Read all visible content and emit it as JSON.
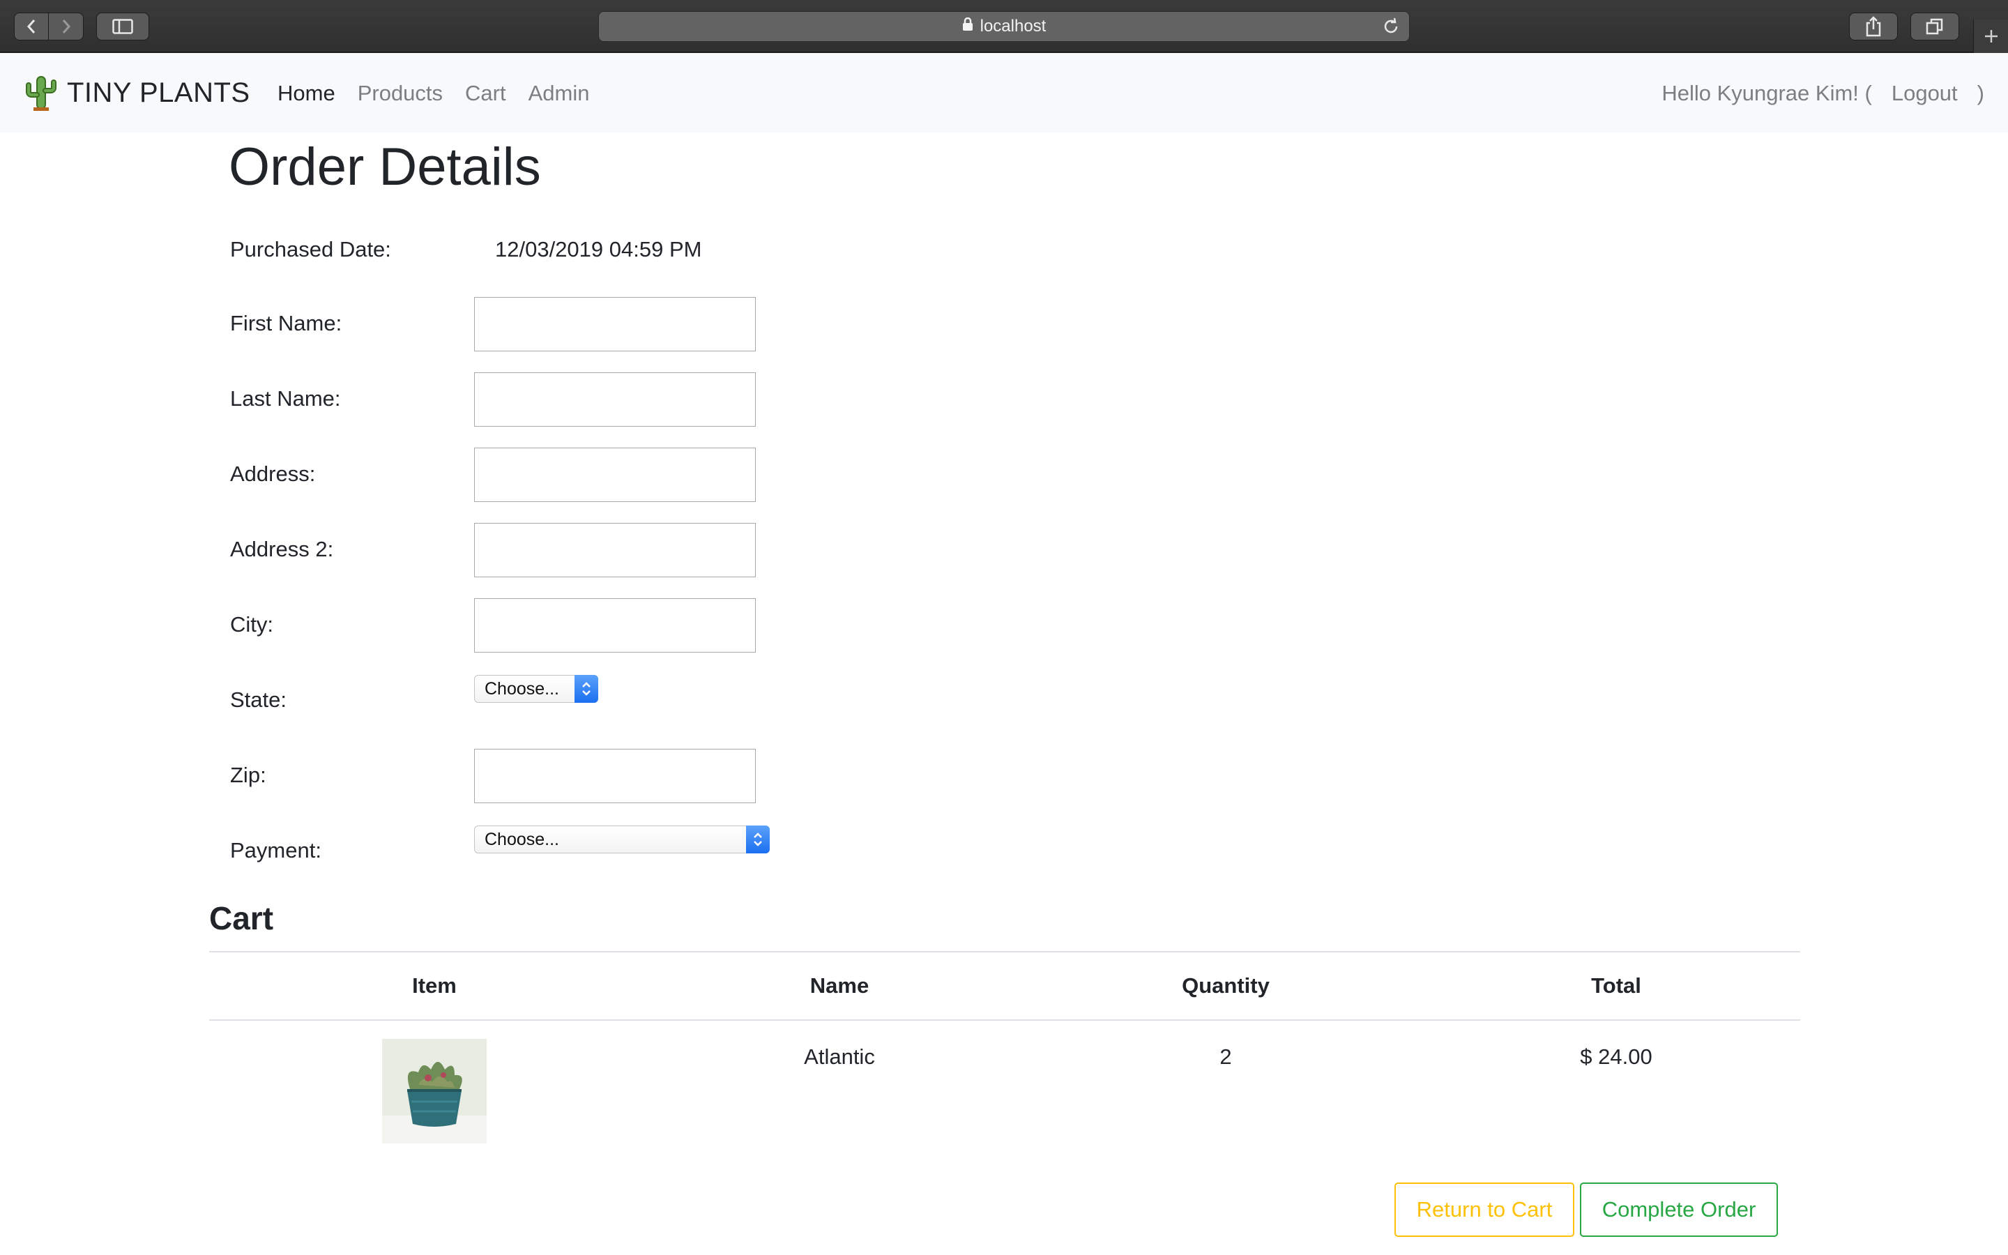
{
  "browser": {
    "url": "localhost",
    "icons": [
      "back-icon",
      "forward-icon",
      "sidebar-icon",
      "lock-icon",
      "reload-icon",
      "share-icon",
      "tabs-icon",
      "new-tab-icon"
    ]
  },
  "navbar": {
    "brand": "TINY PLANTS",
    "brand_icon": "cactus-icon",
    "links": [
      "Home",
      "Products",
      "Cart",
      "Admin"
    ],
    "greeting": "Hello Kyungrae Kim! (",
    "logout": "Logout",
    "closing": ")"
  },
  "page": {
    "title": "Order Details",
    "purchased_label": "Purchased Date:",
    "purchased_value": "12/03/2019 04:59 PM"
  },
  "form": {
    "first_name": {
      "label": "First Name:",
      "value": ""
    },
    "last_name": {
      "label": "Last Name:",
      "value": ""
    },
    "address": {
      "label": "Address:",
      "value": ""
    },
    "address2": {
      "label": "Address 2:",
      "value": ""
    },
    "city": {
      "label": "City:",
      "value": ""
    },
    "state": {
      "label": "State:",
      "selected": "Choose..."
    },
    "zip": {
      "label": "Zip:",
      "value": ""
    },
    "payment": {
      "label": "Payment:",
      "selected": "Choose..."
    }
  },
  "cart": {
    "title": "Cart",
    "columns": [
      "Item",
      "Name",
      "Quantity",
      "Total"
    ],
    "rows": [
      {
        "image": "succulent-pot-image",
        "name": "Atlantic",
        "quantity": "2",
        "total": "$ 24.00"
      }
    ]
  },
  "actions": {
    "return_label": "Return to Cart",
    "complete_label": "Complete Order"
  },
  "colors": {
    "warning": "#ffc107",
    "success": "#28a745",
    "navbar_bg": "#f8f9fa",
    "select_accent": "#1c6ff0"
  }
}
